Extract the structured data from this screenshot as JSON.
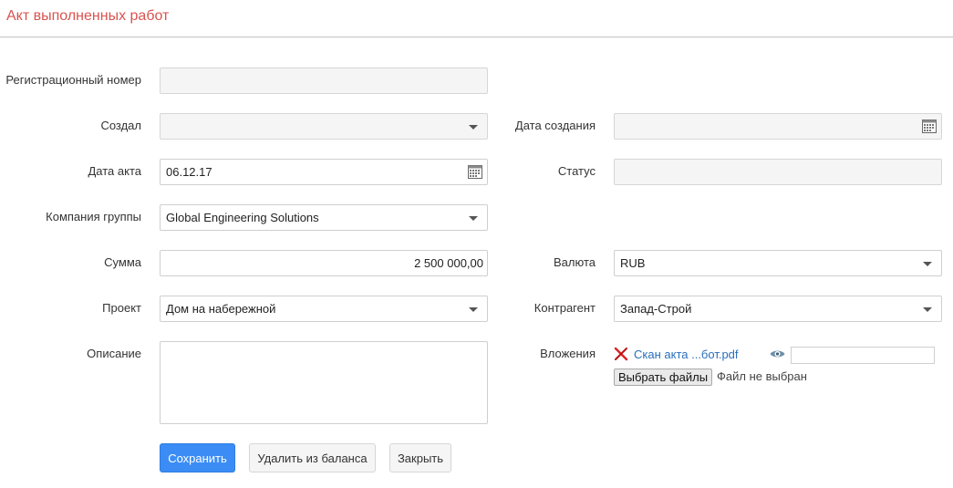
{
  "header": {
    "title": "Акт выполненных работ"
  },
  "form": {
    "reg_number": {
      "label": "Регистрационный номер",
      "value": ""
    },
    "created_by": {
      "label": "Создал",
      "value": ""
    },
    "created_date": {
      "label": "Дата создания",
      "value": ""
    },
    "act_date": {
      "label": "Дата акта",
      "value": "06.12.17"
    },
    "status": {
      "label": "Статус",
      "value": ""
    },
    "company": {
      "label": "Компания группы",
      "value": "Global Engineering Solutions"
    },
    "amount": {
      "label": "Сумма",
      "value": "2 500 000,00"
    },
    "currency": {
      "label": "Валюта",
      "value": "RUB"
    },
    "project": {
      "label": "Проект",
      "value": "Дом на набережной"
    },
    "counterparty": {
      "label": "Контрагент",
      "value": "Запад-Строй"
    },
    "description": {
      "label": "Описание",
      "value": ""
    },
    "attachments": {
      "label": "Вложения",
      "file_name": "Скан акта ...бот.pdf",
      "choose_label": "Выбрать файлы",
      "no_file_text": "Файл не выбран"
    }
  },
  "buttons": {
    "save": "Сохранить",
    "remove": "Удалить из баланса",
    "close": "Закрыть"
  },
  "icons": {
    "calendar": "calendar-icon",
    "dropdown": "chevron-down-icon",
    "remove_file": "close-icon",
    "preview": "eye-icon"
  },
  "colors": {
    "title": "#d9534f",
    "primary": "#3b8df5",
    "link": "#2a6fbd"
  }
}
